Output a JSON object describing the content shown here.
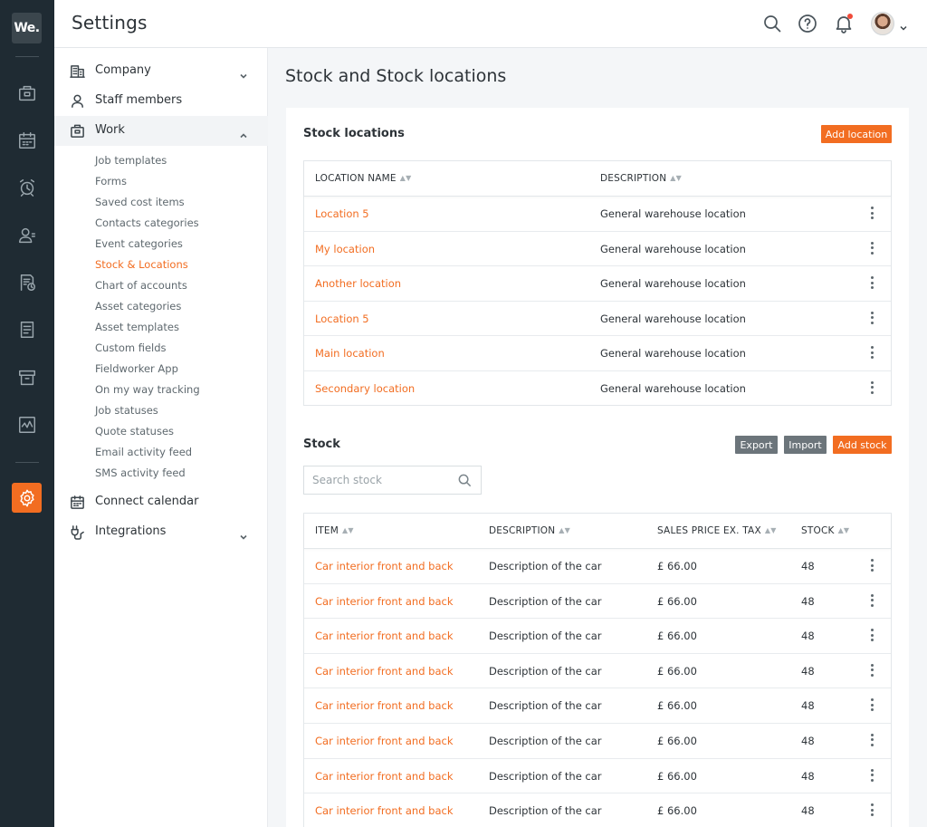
{
  "app": {
    "logo_text": "We.",
    "header_title": "Settings",
    "accent": "#f26d21",
    "rail_bg": "#1f2b33"
  },
  "rail": {
    "items": [
      {
        "icon": "briefcase-icon"
      },
      {
        "icon": "calendar-icon"
      },
      {
        "icon": "alarm-clock-icon"
      },
      {
        "icon": "contacts-icon"
      },
      {
        "icon": "invoice-clock-icon"
      },
      {
        "icon": "document-icon"
      },
      {
        "icon": "archive-icon"
      },
      {
        "icon": "activity-chart-icon"
      },
      {
        "icon": "settings-gear-icon",
        "active": true
      }
    ]
  },
  "header_icons": [
    "search-icon",
    "help-icon",
    "bell-icon",
    "avatar",
    "chevron-down-icon"
  ],
  "sidebar": {
    "items": [
      {
        "label": "Company",
        "icon": "building-icon",
        "expandable": true
      },
      {
        "label": "Staff members",
        "icon": "user-icon"
      },
      {
        "label": "Work",
        "icon": "briefcase-icon",
        "expanded": true
      },
      {
        "label": "Connect calendar",
        "icon": "calendar-icon"
      },
      {
        "label": "Integrations",
        "icon": "plug-icon",
        "expandable": true
      }
    ],
    "work_sub": [
      "Job templates",
      "Forms",
      "Saved cost items",
      "Contacts categories",
      "Event categories",
      "Stock & Locations",
      "Chart of accounts",
      "Asset categories",
      "Asset templates",
      "Custom fields",
      "Fieldworker App",
      "On my way tracking",
      "Job statuses",
      "Quote statuses",
      "Email activity feed",
      "SMS activity feed"
    ],
    "work_sub_current": "Stock & Locations"
  },
  "main": {
    "page_title": "Stock and Stock locations",
    "locations": {
      "title": "Stock locations",
      "add_button": "Add location",
      "columns": [
        "LOCATION NAME",
        "DESCRIPTION"
      ],
      "rows": [
        {
          "name": "Location 5",
          "description": "General warehouse location"
        },
        {
          "name": "My location",
          "description": "General warehouse location"
        },
        {
          "name": "Another location",
          "description": "General warehouse location"
        },
        {
          "name": "Location 5",
          "description": "General warehouse location"
        },
        {
          "name": "Main location",
          "description": "General warehouse location"
        },
        {
          "name": "Secondary location",
          "description": "General warehouse location"
        }
      ]
    },
    "stock": {
      "title": "Stock",
      "export_button": "Export",
      "import_button": "Import",
      "add_button": "Add stock",
      "search_placeholder": "Search stock",
      "columns": [
        "ITEM",
        "DESCRIPTION",
        "SALES PRICE EX. TAX",
        "STOCK"
      ],
      "rows": [
        {
          "item": "Car interior front and back",
          "description": "Description of the car",
          "price": "£ 66.00",
          "stock": "48"
        },
        {
          "item": "Car interior front and back",
          "description": "Description of the car",
          "price": "£ 66.00",
          "stock": "48"
        },
        {
          "item": "Car interior front and back",
          "description": "Description of the car",
          "price": "£ 66.00",
          "stock": "48"
        },
        {
          "item": "Car interior front and back",
          "description": "Description of the car",
          "price": "£ 66.00",
          "stock": "48"
        },
        {
          "item": "Car interior front and back",
          "description": "Description of the car",
          "price": "£ 66.00",
          "stock": "48"
        },
        {
          "item": "Car interior front and back",
          "description": "Description of the car",
          "price": "£ 66.00",
          "stock": "48"
        },
        {
          "item": "Car interior front and back",
          "description": "Description of the car",
          "price": "£ 66.00",
          "stock": "48"
        },
        {
          "item": "Car interior front and back",
          "description": "Description of the car",
          "price": "£ 66.00",
          "stock": "48"
        }
      ]
    }
  }
}
